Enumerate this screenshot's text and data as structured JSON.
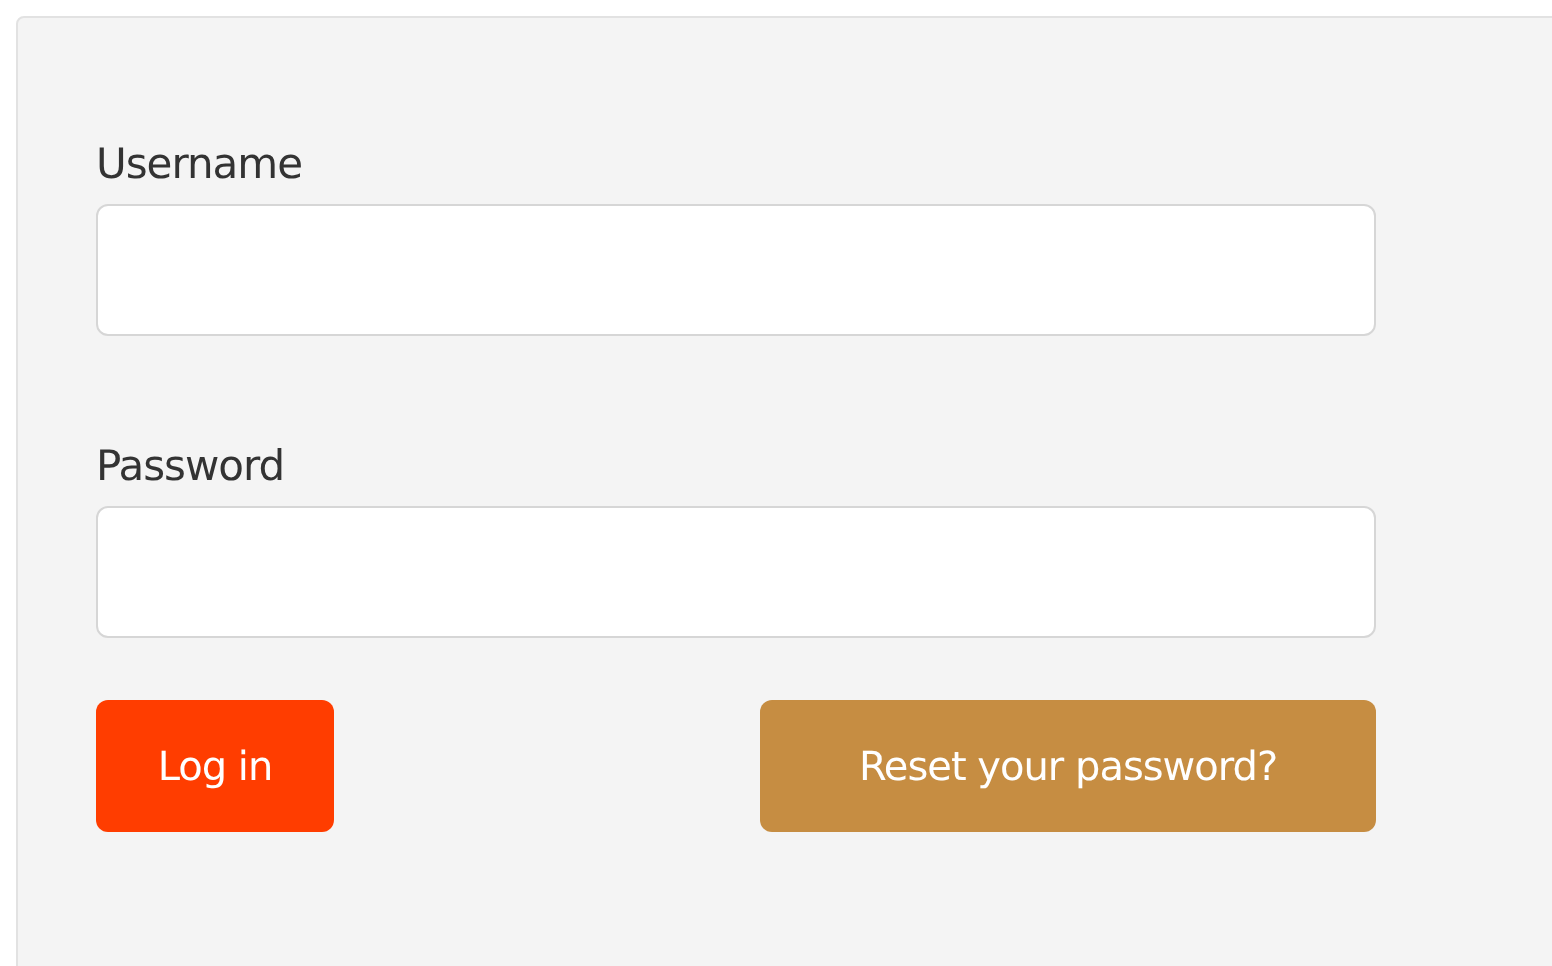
{
  "fields": [
    {
      "label": "Username"
    },
    {
      "label": "Password"
    }
  ],
  "buttons": [
    {
      "label": "Log in",
      "kind": "primary"
    },
    {
      "label": "Reset your password?",
      "kind": "secondary"
    }
  ]
}
